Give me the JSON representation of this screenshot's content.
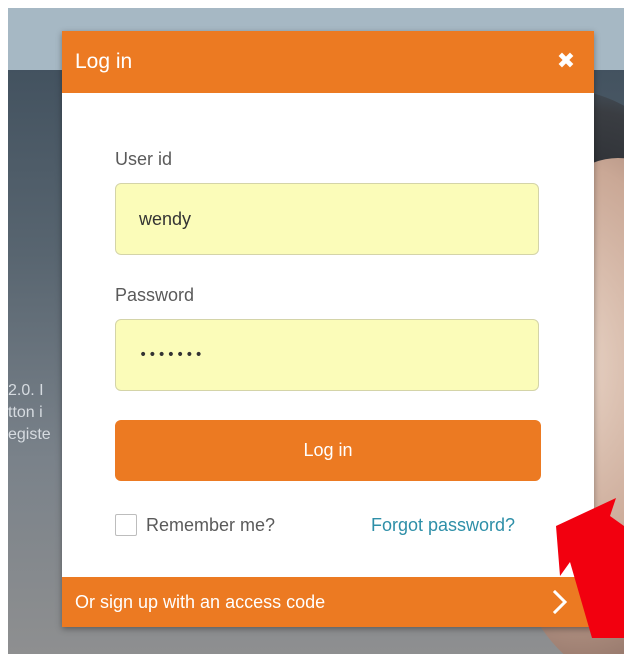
{
  "modal": {
    "title": "Log in",
    "close_glyph": "✖",
    "close_icon": "close-icon"
  },
  "background": {
    "text_lines": [
      "2.0. I",
      "tton i",
      "egiste"
    ]
  },
  "form": {
    "user_label": "User id",
    "user_value": "wendy",
    "password_label": "Password",
    "password_value": "•••••••",
    "login_button": "Log in",
    "remember_label": "Remember me?",
    "remember_checked": false,
    "forgot_link": "Forgot password?"
  },
  "signup": {
    "label": "Or sign up with an access code",
    "icon": "chevron-right-icon"
  },
  "colors": {
    "accent": "#ec7a22",
    "field_bg": "#fbfcb9",
    "link": "#2e8fa8",
    "annotation_arrow": "#f2000f"
  }
}
